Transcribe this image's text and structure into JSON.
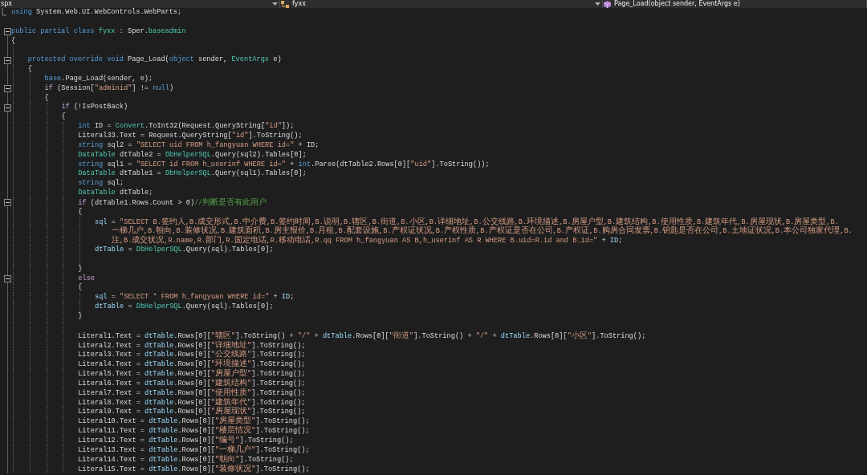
{
  "navigation_bar": [
    {
      "kind": "file",
      "label": "spx",
      "caret": true
    },
    {
      "kind": "class",
      "label": "fyxx",
      "caret": true
    },
    {
      "kind": "method",
      "label": "Page_Load(object sender, EventArgs e)"
    }
  ],
  "code": [
    {
      "kind": "code",
      "fold_end": true,
      "tokens": [
        {
          "kind": "keyword",
          "text": "using"
        },
        {
          "kind": "plain",
          "text": " System.Web.UI.WebControls.WebParts;"
        }
      ]
    },
    {
      "kind": "blank"
    },
    {
      "kind": "code",
      "expanded": true,
      "tokens": [
        {
          "kind": "keyword",
          "text": "public partial class "
        },
        {
          "kind": "type",
          "text": "fyxx"
        },
        {
          "kind": "plain",
          "text": " : Sper."
        },
        {
          "kind": "type",
          "text": "baseadmin"
        }
      ]
    },
    {
      "kind": "code",
      "tokens": [
        {
          "kind": "plain",
          "text": "{"
        }
      ],
      "children": [
        {
          "kind": "blank"
        },
        {
          "kind": "code",
          "expanded": true,
          "tokens": [
            {
              "kind": "keyword",
              "text": "protected override void"
            },
            {
              "kind": "plain",
              "text": " Page_Load("
            },
            {
              "kind": "keyword",
              "text": "object"
            },
            {
              "kind": "plain",
              "text": " sender, "
            },
            {
              "kind": "type",
              "text": "EventArgs"
            },
            {
              "kind": "plain",
              "text": " e)"
            }
          ]
        },
        {
          "kind": "code",
          "tokens": [
            {
              "kind": "plain",
              "text": "{"
            }
          ],
          "children": [
            {
              "kind": "code",
              "tokens": [
                {
                  "kind": "keyword",
                  "text": "base"
                },
                {
                  "kind": "plain",
                  "text": ".Page_Load(sender, e);"
                }
              ]
            },
            {
              "kind": "code",
              "expanded": true,
              "tokens": [
                {
                  "kind": "control",
                  "text": "if"
                },
                {
                  "kind": "plain",
                  "text": " (Session["
                },
                {
                  "kind": "string",
                  "text": "\"adminid\""
                },
                {
                  "kind": "plain",
                  "text": "] != "
                },
                {
                  "kind": "keyword",
                  "text": "null"
                },
                {
                  "kind": "plain",
                  "text": ")"
                }
              ]
            },
            {
              "kind": "code",
              "tokens": [
                {
                  "kind": "plain",
                  "text": "{"
                }
              ],
              "children": [
                {
                  "kind": "code",
                  "expanded": true,
                  "tokens": [
                    {
                      "kind": "control",
                      "text": "if"
                    },
                    {
                      "kind": "plain",
                      "text": " (!IsPostBack)"
                    }
                  ]
                },
                {
                  "kind": "code",
                  "tokens": [
                    {
                      "kind": "plain",
                      "text": "{"
                    }
                  ],
                  "children": [
                    {
                      "kind": "code",
                      "tokens": [
                        {
                          "kind": "keyword",
                          "text": "int"
                        },
                        {
                          "kind": "plain",
                          "text": " ID = "
                        },
                        {
                          "kind": "type",
                          "text": "Convert"
                        },
                        {
                          "kind": "plain",
                          "text": ".ToInt32(Request.QueryString["
                        },
                        {
                          "kind": "string",
                          "text": "\"id\""
                        },
                        {
                          "kind": "plain",
                          "text": "]);"
                        }
                      ]
                    },
                    {
                      "kind": "code",
                      "tokens": [
                        {
                          "kind": "plain",
                          "text": "Literal33.Text = Request.QueryString["
                        },
                        {
                          "kind": "string",
                          "text": "\"id\""
                        },
                        {
                          "kind": "plain",
                          "text": "].ToString();"
                        }
                      ]
                    },
                    {
                      "kind": "code",
                      "tokens": [
                        {
                          "kind": "keyword",
                          "text": "string"
                        },
                        {
                          "kind": "plain",
                          "text": " sql2 = "
                        },
                        {
                          "kind": "string",
                          "text": "\"SELECT uid FROM h_fangyuan WHERE id=\""
                        },
                        {
                          "kind": "plain",
                          "text": " + ID;"
                        }
                      ]
                    },
                    {
                      "kind": "code",
                      "tokens": [
                        {
                          "kind": "type",
                          "text": "DataTable"
                        },
                        {
                          "kind": "plain",
                          "text": " dtTable2 = "
                        },
                        {
                          "kind": "type",
                          "text": "DbHelperSQL"
                        },
                        {
                          "kind": "plain",
                          "text": ".Query(sql2).Tables[0];"
                        }
                      ]
                    },
                    {
                      "kind": "code",
                      "tokens": [
                        {
                          "kind": "keyword",
                          "text": "string"
                        },
                        {
                          "kind": "plain",
                          "text": " sql1 = "
                        },
                        {
                          "kind": "string",
                          "text": "\"SELECT id FROM h_userinf WHERE id=\""
                        },
                        {
                          "kind": "plain",
                          "text": " + "
                        },
                        {
                          "kind": "keyword",
                          "text": "int"
                        },
                        {
                          "kind": "plain",
                          "text": ".Parse(dtTable2.Rows[0]["
                        },
                        {
                          "kind": "string",
                          "text": "\"uid\""
                        },
                        {
                          "kind": "plain",
                          "text": "].ToString());"
                        }
                      ]
                    },
                    {
                      "kind": "code",
                      "tokens": [
                        {
                          "kind": "type",
                          "text": "DataTable"
                        },
                        {
                          "kind": "plain",
                          "text": " dtTable1 = "
                        },
                        {
                          "kind": "type",
                          "text": "DbHelperSQL"
                        },
                        {
                          "kind": "plain",
                          "text": ".Query(sql1).Tables[0];"
                        }
                      ]
                    },
                    {
                      "kind": "code",
                      "tokens": [
                        {
                          "kind": "keyword",
                          "text": "string"
                        },
                        {
                          "kind": "plain",
                          "text": " sql;"
                        }
                      ]
                    },
                    {
                      "kind": "code",
                      "tokens": [
                        {
                          "kind": "type",
                          "text": "DataTable"
                        },
                        {
                          "kind": "plain",
                          "text": " dtTable;"
                        }
                      ]
                    },
                    {
                      "kind": "code",
                      "expanded": true,
                      "tokens": [
                        {
                          "kind": "control",
                          "text": "if"
                        },
                        {
                          "kind": "plain",
                          "text": " (dtTable1.Rows.Count > 0)"
                        },
                        {
                          "kind": "comment",
                          "text": "//判断是否有此用户"
                        }
                      ]
                    },
                    {
                      "kind": "code",
                      "tokens": [
                        {
                          "kind": "plain",
                          "text": "{"
                        }
                      ],
                      "children": [
                        {
                          "kind": "code",
                          "tokens": [
                            {
                              "kind": "variable",
                              "text": "sql"
                            },
                            {
                              "kind": "plain",
                              "text": " = "
                            },
                            {
                              "kind": "string",
                              "text": "\"SELECT B.签约人,B.成交形式,B.中介费,B.签约时间,B.说明,B.辖区,B.街道,B.小区,B.详细地址,B.公交线路,B.环境描述,B.房屋户型,B.建筑结构,B.使用性质,B.建筑年代,B.房屋现状,B.房屋类型,B."
                            }
                          ],
                          "wrapped_lines": [
                            {
                              "tokens": [
                                {
                                  "kind": "string",
                                  "text": "一梯几户,B.朝向,B.装修状况,B.建筑面积,B.房主报价,B.月租,B.配套设施,B.产权证状况,B.产权性质,B.产权证是否在公司,B.产权证,B.购房合同发票,B.钥匙是否在公司,B.土地证状况,B.本公司独家代理,B."
                                }
                              ]
                            },
                            {
                              "tokens": [
                                {
                                  "kind": "string",
                                  "text": "注,B.成交状况,R.name,R.部门,R.固定电话,R.移动电话,R.qq FROM h_fangyuan AS B,h_userinf AS R WHERE B.uid=R.id and B.id=\""
                                },
                                {
                                  "kind": "plain",
                                  "text": " + "
                                },
                                {
                                  "kind": "variable",
                                  "text": "ID"
                                },
                                {
                                  "kind": "plain",
                                  "text": ";"
                                }
                              ]
                            }
                          ]
                        },
                        {
                          "kind": "code",
                          "tokens": [
                            {
                              "kind": "variable",
                              "text": "dtTable"
                            },
                            {
                              "kind": "plain",
                              "text": " = "
                            },
                            {
                              "kind": "type",
                              "text": "DbHelperSQL"
                            },
                            {
                              "kind": "plain",
                              "text": ".Query(sql).Tables[0];"
                            }
                          ]
                        },
                        {
                          "kind": "blank"
                        }
                      ]
                    },
                    {
                      "kind": "code",
                      "tokens": [
                        {
                          "kind": "plain",
                          "text": "}"
                        }
                      ]
                    },
                    {
                      "kind": "code",
                      "expanded": true,
                      "tokens": [
                        {
                          "kind": "control",
                          "text": "else"
                        }
                      ]
                    },
                    {
                      "kind": "code",
                      "tokens": [
                        {
                          "kind": "plain",
                          "text": "{"
                        }
                      ],
                      "children": [
                        {
                          "kind": "code",
                          "tokens": [
                            {
                              "kind": "variable",
                              "text": "sql"
                            },
                            {
                              "kind": "plain",
                              "text": " = "
                            },
                            {
                              "kind": "string",
                              "text": "\"SELECT * FROM h_fangyuan WHERE id=\""
                            },
                            {
                              "kind": "plain",
                              "text": " + "
                            },
                            {
                              "kind": "variable",
                              "text": "ID"
                            },
                            {
                              "kind": "plain",
                              "text": ";"
                            }
                          ]
                        },
                        {
                          "kind": "code",
                          "tokens": [
                            {
                              "kind": "variable",
                              "text": "dtTable"
                            },
                            {
                              "kind": "plain",
                              "text": " = "
                            },
                            {
                              "kind": "type",
                              "text": "DbHelperSQL"
                            },
                            {
                              "kind": "plain",
                              "text": ".Query(sql).Tables[0];"
                            }
                          ]
                        }
                      ]
                    },
                    {
                      "kind": "code",
                      "tokens": [
                        {
                          "kind": "plain",
                          "text": "}"
                        }
                      ]
                    },
                    {
                      "kind": "blank"
                    },
                    {
                      "kind": "code",
                      "tokens": [
                        {
                          "kind": "plain",
                          "text": "Literal1.Text = "
                        },
                        {
                          "kind": "variable",
                          "text": "dtTable"
                        },
                        {
                          "kind": "plain",
                          "text": ".Rows[0]["
                        },
                        {
                          "kind": "string",
                          "text": "\"辖区\""
                        },
                        {
                          "kind": "plain",
                          "text": "].ToString() + "
                        },
                        {
                          "kind": "string",
                          "text": "\"/\""
                        },
                        {
                          "kind": "plain",
                          "text": " + "
                        },
                        {
                          "kind": "variable",
                          "text": "dtTable"
                        },
                        {
                          "kind": "plain",
                          "text": ".Rows[0]["
                        },
                        {
                          "kind": "string",
                          "text": "\"街道\""
                        },
                        {
                          "kind": "plain",
                          "text": "].ToString() + "
                        },
                        {
                          "kind": "string",
                          "text": "\"/\""
                        },
                        {
                          "kind": "plain",
                          "text": " + "
                        },
                        {
                          "kind": "variable",
                          "text": "dtTable"
                        },
                        {
                          "kind": "plain",
                          "text": ".Rows[0]["
                        },
                        {
                          "kind": "string",
                          "text": "\"小区\""
                        },
                        {
                          "kind": "plain",
                          "text": "].ToString();"
                        }
                      ]
                    },
                    {
                      "kind": "code",
                      "tokens": [
                        {
                          "kind": "plain",
                          "text": "Literal2.Text = "
                        },
                        {
                          "kind": "variable",
                          "text": "dtTable"
                        },
                        {
                          "kind": "plain",
                          "text": ".Rows[0]["
                        },
                        {
                          "kind": "string",
                          "text": "\"详细地址\""
                        },
                        {
                          "kind": "plain",
                          "text": "].ToString();"
                        }
                      ]
                    },
                    {
                      "kind": "code",
                      "tokens": [
                        {
                          "kind": "plain",
                          "text": "Literal3.Text = "
                        },
                        {
                          "kind": "variable",
                          "text": "dtTable"
                        },
                        {
                          "kind": "plain",
                          "text": ".Rows[0]["
                        },
                        {
                          "kind": "string",
                          "text": "\"公交线路\""
                        },
                        {
                          "kind": "plain",
                          "text": "].ToString();"
                        }
                      ]
                    },
                    {
                      "kind": "code",
                      "tokens": [
                        {
                          "kind": "plain",
                          "text": "Literal4.Text = "
                        },
                        {
                          "kind": "variable",
                          "text": "dtTable"
                        },
                        {
                          "kind": "plain",
                          "text": ".Rows[0]["
                        },
                        {
                          "kind": "string",
                          "text": "\"环境描述\""
                        },
                        {
                          "kind": "plain",
                          "text": "].ToString();"
                        }
                      ]
                    },
                    {
                      "kind": "code",
                      "tokens": [
                        {
                          "kind": "plain",
                          "text": "Literal5.Text = "
                        },
                        {
                          "kind": "variable",
                          "text": "dtTable"
                        },
                        {
                          "kind": "plain",
                          "text": ".Rows[0]["
                        },
                        {
                          "kind": "string",
                          "text": "\"房屋户型\""
                        },
                        {
                          "kind": "plain",
                          "text": "].ToString();"
                        }
                      ]
                    },
                    {
                      "kind": "code",
                      "tokens": [
                        {
                          "kind": "plain",
                          "text": "Literal6.Text = "
                        },
                        {
                          "kind": "variable",
                          "text": "dtTable"
                        },
                        {
                          "kind": "plain",
                          "text": ".Rows[0]["
                        },
                        {
                          "kind": "string",
                          "text": "\"建筑结构\""
                        },
                        {
                          "kind": "plain",
                          "text": "].ToString();"
                        }
                      ]
                    },
                    {
                      "kind": "code",
                      "tokens": [
                        {
                          "kind": "plain",
                          "text": "Literal7.Text = "
                        },
                        {
                          "kind": "variable",
                          "text": "dtTable"
                        },
                        {
                          "kind": "plain",
                          "text": ".Rows[0]["
                        },
                        {
                          "kind": "string",
                          "text": "\"使用性质\""
                        },
                        {
                          "kind": "plain",
                          "text": "].ToString();"
                        }
                      ]
                    },
                    {
                      "kind": "code",
                      "tokens": [
                        {
                          "kind": "plain",
                          "text": "Literal8.Text = "
                        },
                        {
                          "kind": "variable",
                          "text": "dtTable"
                        },
                        {
                          "kind": "plain",
                          "text": ".Rows[0]["
                        },
                        {
                          "kind": "string",
                          "text": "\"建筑年代\""
                        },
                        {
                          "kind": "plain",
                          "text": "].ToString();"
                        }
                      ]
                    },
                    {
                      "kind": "code",
                      "tokens": [
                        {
                          "kind": "plain",
                          "text": "Literal9.Text = "
                        },
                        {
                          "kind": "variable",
                          "text": "dtTable"
                        },
                        {
                          "kind": "plain",
                          "text": ".Rows[0]["
                        },
                        {
                          "kind": "string",
                          "text": "\"房屋现状\""
                        },
                        {
                          "kind": "plain",
                          "text": "].ToString();"
                        }
                      ]
                    },
                    {
                      "kind": "code",
                      "tokens": [
                        {
                          "kind": "plain",
                          "text": "Literal10.Text = "
                        },
                        {
                          "kind": "variable",
                          "text": "dtTable"
                        },
                        {
                          "kind": "plain",
                          "text": ".Rows[0]["
                        },
                        {
                          "kind": "string",
                          "text": "\"房屋类型\""
                        },
                        {
                          "kind": "plain",
                          "text": "].ToString();"
                        }
                      ]
                    },
                    {
                      "kind": "code",
                      "tokens": [
                        {
                          "kind": "plain",
                          "text": "Literal11.Text = "
                        },
                        {
                          "kind": "variable",
                          "text": "dtTable"
                        },
                        {
                          "kind": "plain",
                          "text": ".Rows[0]["
                        },
                        {
                          "kind": "string",
                          "text": "\"楼层情况\""
                        },
                        {
                          "kind": "plain",
                          "text": "].ToString();"
                        }
                      ]
                    },
                    {
                      "kind": "code",
                      "tokens": [
                        {
                          "kind": "plain",
                          "text": "Literal12.Text = "
                        },
                        {
                          "kind": "variable",
                          "text": "dtTable"
                        },
                        {
                          "kind": "plain",
                          "text": ".Rows[0]["
                        },
                        {
                          "kind": "string",
                          "text": "\"编号\""
                        },
                        {
                          "kind": "plain",
                          "text": "].ToString();"
                        }
                      ]
                    },
                    {
                      "kind": "code",
                      "tokens": [
                        {
                          "kind": "plain",
                          "text": "Literal13.Text = "
                        },
                        {
                          "kind": "variable",
                          "text": "dtTable"
                        },
                        {
                          "kind": "plain",
                          "text": ".Rows[0]["
                        },
                        {
                          "kind": "string",
                          "text": "\"一梯几户\""
                        },
                        {
                          "kind": "plain",
                          "text": "].ToString();"
                        }
                      ]
                    },
                    {
                      "kind": "code",
                      "tokens": [
                        {
                          "kind": "plain",
                          "text": "Literal14.Text = "
                        },
                        {
                          "kind": "variable",
                          "text": "dtTable"
                        },
                        {
                          "kind": "plain",
                          "text": ".Rows[0]["
                        },
                        {
                          "kind": "string",
                          "text": "\"朝向\""
                        },
                        {
                          "kind": "plain",
                          "text": "].ToString();"
                        }
                      ]
                    },
                    {
                      "kind": "code",
                      "tokens": [
                        {
                          "kind": "plain",
                          "text": "Literal15.Text = "
                        },
                        {
                          "kind": "variable",
                          "text": "dtTable"
                        },
                        {
                          "kind": "plain",
                          "text": ".Rows[0]["
                        },
                        {
                          "kind": "string",
                          "text": "\"装修状况\""
                        },
                        {
                          "kind": "plain",
                          "text": "].ToString();"
                        }
                      ]
                    }
                  ]
                }
              ]
            }
          ]
        }
      ]
    }
  ]
}
